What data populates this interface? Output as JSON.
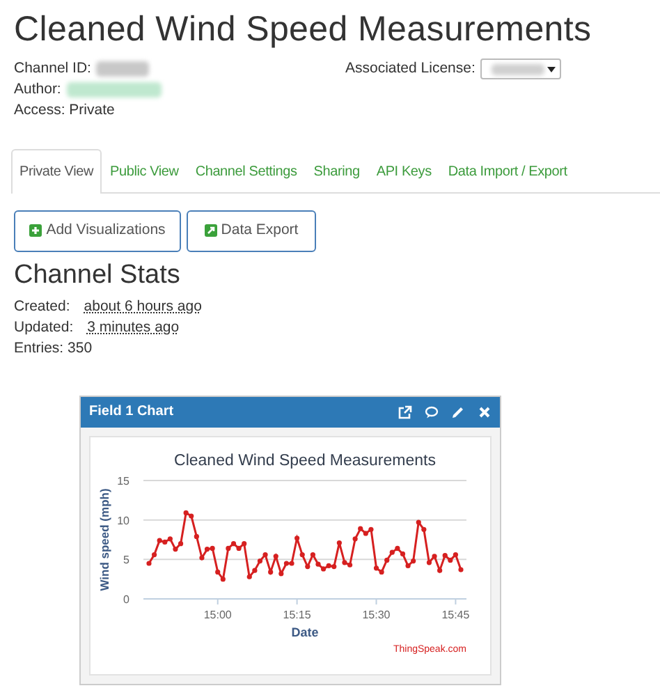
{
  "title": "Cleaned Wind Speed Measurements",
  "info": [
    {
      "label": "Channel ID:"
    },
    {
      "label": "Author:"
    },
    {
      "label": "Access: Private"
    }
  ],
  "license": {
    "label": "Associated License:"
  },
  "tabs": [
    {
      "label": "Private View",
      "selected": true
    },
    {
      "label": "Public View",
      "selected": false
    },
    {
      "label": "Channel Settings",
      "selected": false
    },
    {
      "label": "Sharing",
      "selected": false
    },
    {
      "label": "API Keys",
      "selected": false
    },
    {
      "label": "Data Import / Export",
      "selected": false
    }
  ],
  "buttons": [
    {
      "label": "Add Visualizations",
      "kind": "add"
    },
    {
      "label": "Data Export",
      "kind": "export"
    }
  ],
  "stats": {
    "heading": "Channel Stats",
    "rows": [
      {
        "label": "Created:",
        "value": "about 6 hours ago"
      },
      {
        "label": "Updated:",
        "value": "3 minutes ago"
      },
      {
        "label": "Entries: 350"
      }
    ]
  },
  "widget": {
    "title": "Field 1 Chart",
    "footer": "ThingSpeak.com",
    "chart_data": {
      "type": "line",
      "title": "Cleaned Wind Speed Measurements",
      "xlabel": "Date",
      "ylabel": "Wind speed (mph)",
      "ylim": [
        0,
        15
      ],
      "yticks": [
        0,
        5,
        10,
        15
      ],
      "categories": [
        null,
        null,
        null,
        null,
        null,
        null,
        null,
        null,
        null,
        null,
        null,
        null,
        null,
        "15:00",
        null,
        null,
        null,
        null,
        null,
        null,
        null,
        null,
        null,
        null,
        null,
        null,
        null,
        null,
        "15:15",
        null,
        null,
        null,
        null,
        null,
        null,
        null,
        null,
        null,
        null,
        null,
        null,
        null,
        null,
        "15:30",
        null,
        null,
        null,
        null,
        null,
        null,
        null,
        null,
        null,
        null,
        null,
        null,
        null,
        null,
        "15:45",
        null
      ],
      "series": [
        {
          "color": "#d62020",
          "marker": "circle",
          "values": [
            4.5,
            5.6,
            7.4,
            7.2,
            7.6,
            6.3,
            7.0,
            10.9,
            10.5,
            7.9,
            5.2,
            6.3,
            6.4,
            3.4,
            2.5,
            6.4,
            7.0,
            6.4,
            7.0,
            2.8,
            3.6,
            4.8,
            5.6,
            3.4,
            5.4,
            3.2,
            4.5,
            4.5,
            7.7,
            5.6,
            4.1,
            5.6,
            4.4,
            3.8,
            4.2,
            4.1,
            7.1,
            4.6,
            4.3,
            7.6,
            8.9,
            8.3,
            8.8,
            3.9,
            3.4,
            4.9,
            5.9,
            6.4,
            5.7,
            4.2,
            4.8,
            9.7,
            8.8,
            4.6,
            5.4,
            3.6,
            5.5,
            4.9,
            5.6,
            3.7
          ]
        }
      ]
    }
  }
}
